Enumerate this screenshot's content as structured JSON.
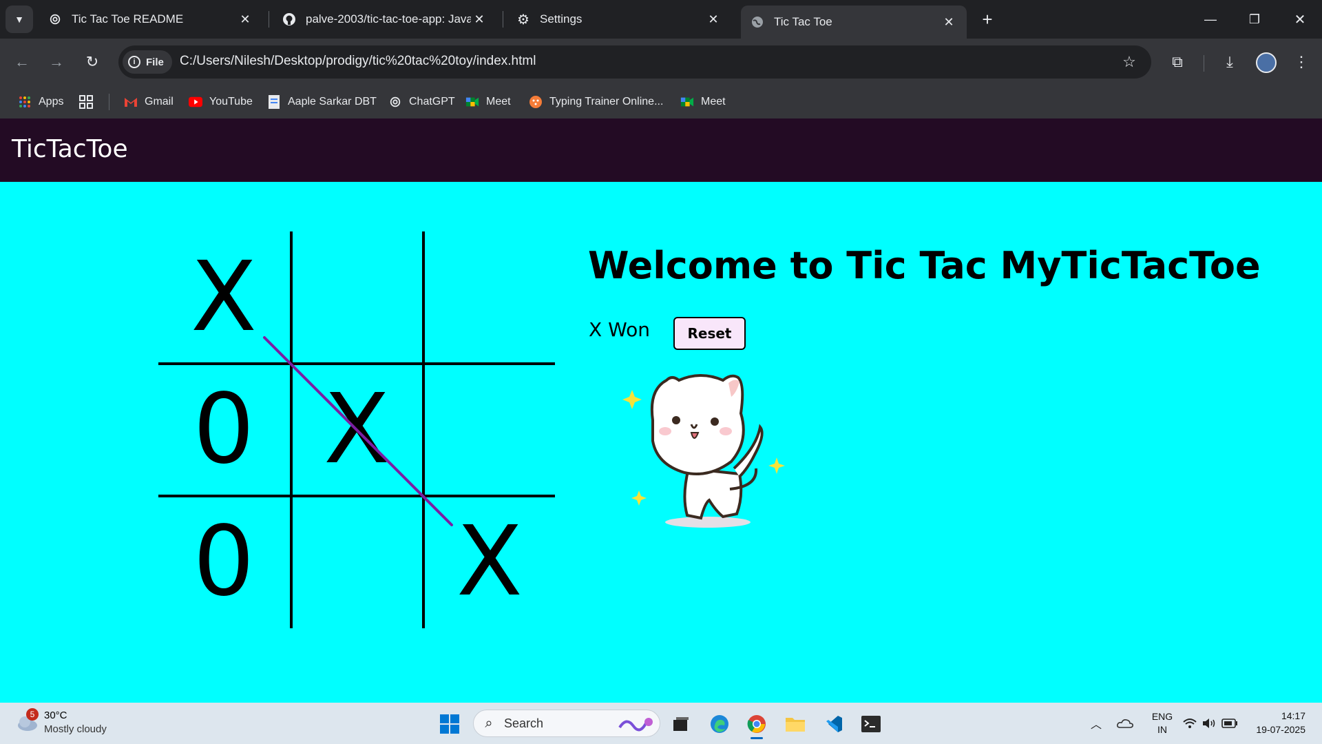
{
  "browser": {
    "tabs": [
      {
        "label": "Tic Tac Toe README",
        "icon": "openai-icon"
      },
      {
        "label": "palve-2003/tic-tac-toe-app: JavaSc",
        "icon": "github-icon"
      },
      {
        "label": "Settings",
        "icon": "gear-icon"
      },
      {
        "label": "Tic Tac Toe",
        "icon": "globe-icon"
      }
    ],
    "new_tab": "+",
    "address": {
      "scheme_label": "File",
      "url": "C:/Users/Nilesh/Desktop/prodigy/tic%20tac%20toy/index.html"
    },
    "bookmarks": [
      {
        "label": "Apps"
      },
      {
        "label": "Gmail"
      },
      {
        "label": "YouTube"
      },
      {
        "label": "Aaple Sarkar DBT"
      },
      {
        "label": "ChatGPT"
      },
      {
        "label": "Meet"
      },
      {
        "label": "Typing Trainer Online..."
      },
      {
        "label": "Meet"
      }
    ]
  },
  "page": {
    "brand": "TicTacToe",
    "heading": "Welcome to Tic Tac MyTicTacToe",
    "status": "X Won",
    "reset_label": "Reset",
    "board": [
      "X",
      "",
      "",
      "0",
      "X",
      "",
      "0",
      "",
      "X"
    ],
    "win_line_color": "#7a1fa2"
  },
  "taskbar": {
    "weather": {
      "badge": "5",
      "temp": "30°C",
      "desc": "Mostly cloudy"
    },
    "search_placeholder": "Search",
    "language": {
      "line1": "ENG",
      "line2": "IN"
    },
    "time": "14:17",
    "date": "19-07-2025"
  }
}
